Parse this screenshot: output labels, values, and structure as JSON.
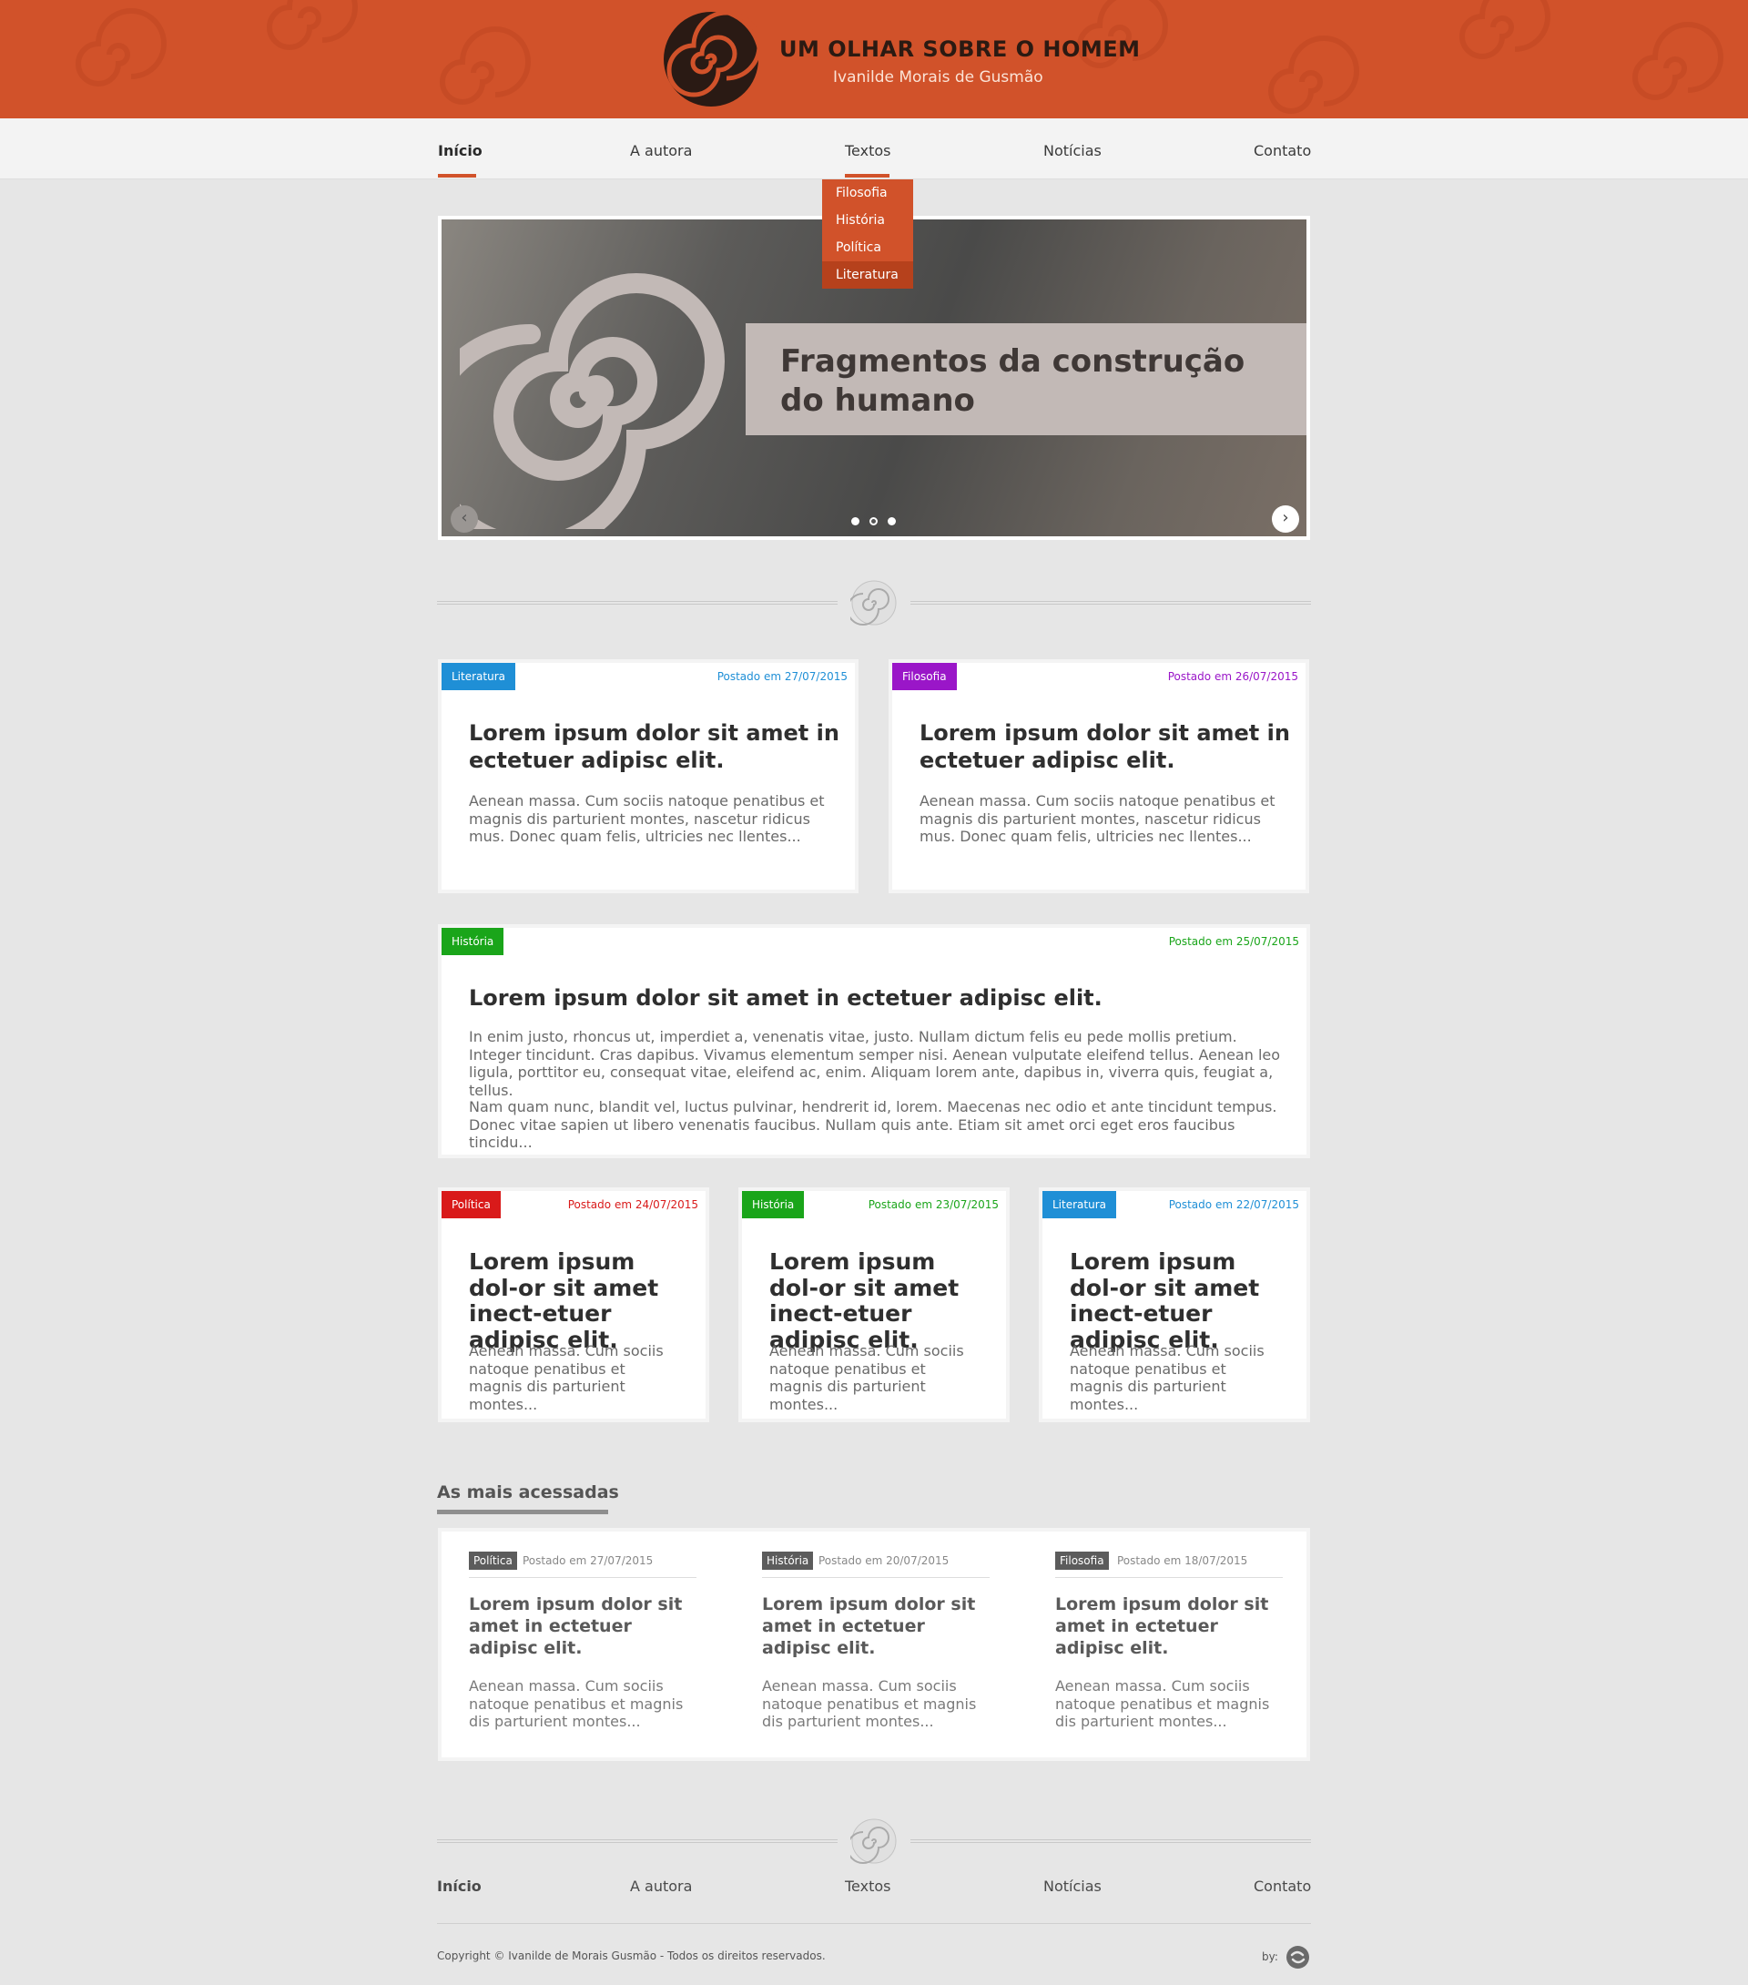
{
  "colors": {
    "brand": "#d1522a",
    "literatura": "#1f8fd6",
    "filosofia": "#9a16c8",
    "historia": "#1aa51a",
    "politica": "#d91a1a",
    "neutral_tag": "#5c5c5c"
  },
  "header": {
    "logo_icon": "spiral-logo-icon",
    "title": "UM OLHAR SOBRE O HOMEM",
    "subtitle": "Ivanilde Morais de Gusmão"
  },
  "nav": {
    "items": [
      {
        "label": "Início",
        "active": true
      },
      {
        "label": "A autora",
        "active": false
      },
      {
        "label": "Textos",
        "active": false,
        "open": true
      },
      {
        "label": "Notícias",
        "active": false
      },
      {
        "label": "Contato",
        "active": false
      }
    ],
    "dropdown": [
      "Filosofia",
      "História",
      "Política",
      "Literatura"
    ],
    "dropdown_highlighted": "Literatura"
  },
  "slider": {
    "title": "Fragmentos da construção do humano",
    "prev_icon": "chevron-left-icon",
    "next_icon": "chevron-right-icon",
    "slide_count": 3,
    "active_slide": 2
  },
  "posts": [
    {
      "tag": "Literatura",
      "date": "Postado em 27/07/2015",
      "title": "Lorem ipsum dolor sit amet in ectetuer adipisc elit.",
      "excerpt": "Aenean massa. Cum sociis natoque penatibus et magnis dis parturient montes, nascetur ridicus mus. Donec quam felis, ultricies nec llentes..."
    },
    {
      "tag": "Filosofia",
      "date": "Postado em 26/07/2015",
      "title": "Lorem ipsum dolor sit amet in ectetuer adipisc elit.",
      "excerpt": "Aenean massa. Cum sociis natoque penatibus et magnis dis parturient montes, nascetur ridicus mus. Donec quam felis, ultricies nec llentes..."
    },
    {
      "tag": "História",
      "date": "Postado em 25/07/2015",
      "title": "Lorem ipsum dolor sit amet in ectetuer adipisc elit.",
      "excerpt": "In enim justo, rhoncus ut, imperdiet a, venenatis vitae, justo. Nullam dictum felis eu pede mollis pretium. Integer tincidunt. Cras dapibus. Vivamus elementum semper nisi. Aenean vulputate eleifend tellus. Aenean leo ligula, porttitor eu, consequat vitae, eleifend ac, enim. Aliquam lorem ante, dapibus in, viverra quis, feugiat a, tellus.",
      "excerpt2": "Nam quam nunc, blandit vel, luctus pulvinar, hendrerit id, lorem. Maecenas nec odio et ante tincidunt tempus. Donec vitae sapien ut libero venenatis faucibus. Nullam quis ante. Etiam sit amet orci eget eros faucibus tincidu..."
    },
    {
      "tag": "Política",
      "date": "Postado em 24/07/2015",
      "title": "Lorem ipsum dol-or sit amet inect-etuer adipisc elit.",
      "excerpt": "Aenean massa. Cum sociis natoque penatibus et magnis dis parturient montes..."
    },
    {
      "tag": "História",
      "date": "Postado em 23/07/2015",
      "title": "Lorem ipsum dol-or sit amet inect-etuer adipisc elit.",
      "excerpt": "Aenean massa. Cum sociis natoque penatibus et magnis dis parturient montes..."
    },
    {
      "tag": "Literatura",
      "date": "Postado em 22/07/2015",
      "title": "Lorem ipsum dol-or sit amet inect-etuer adipisc elit.",
      "excerpt": "Aenean massa. Cum sociis natoque penatibus et magnis dis parturient montes..."
    }
  ],
  "most_accessed": {
    "heading": "As mais acessadas",
    "items": [
      {
        "tag": "Política",
        "date": "Postado em 27/07/2015",
        "title": "Lorem ipsum dolor sit amet in ectetuer adipisc elit.",
        "excerpt": "Aenean massa. Cum sociis natoque penatibus et magnis dis parturient montes..."
      },
      {
        "tag": "História",
        "date": "Postado em 20/07/2015",
        "title": "Lorem ipsum dolor sit amet in ectetuer adipisc elit.",
        "excerpt": "Aenean massa. Cum sociis natoque penatibus et magnis dis parturient montes..."
      },
      {
        "tag": "Filosofia",
        "date": "Postado em 18/07/2015",
        "title": "Lorem ipsum dolor sit amet in ectetuer adipisc elit.",
        "excerpt": "Aenean massa. Cum sociis natoque penatibus et magnis dis parturient montes..."
      }
    ]
  },
  "footer": {
    "nav": [
      "Início",
      "A autora",
      "Textos",
      "Notícias",
      "Contato"
    ],
    "copyright": "Copyright © Ivanilde de Morais Gusmão  - Todos os direitos reservados.",
    "by_label": "by:",
    "by_icon": "agency-logo-icon"
  }
}
